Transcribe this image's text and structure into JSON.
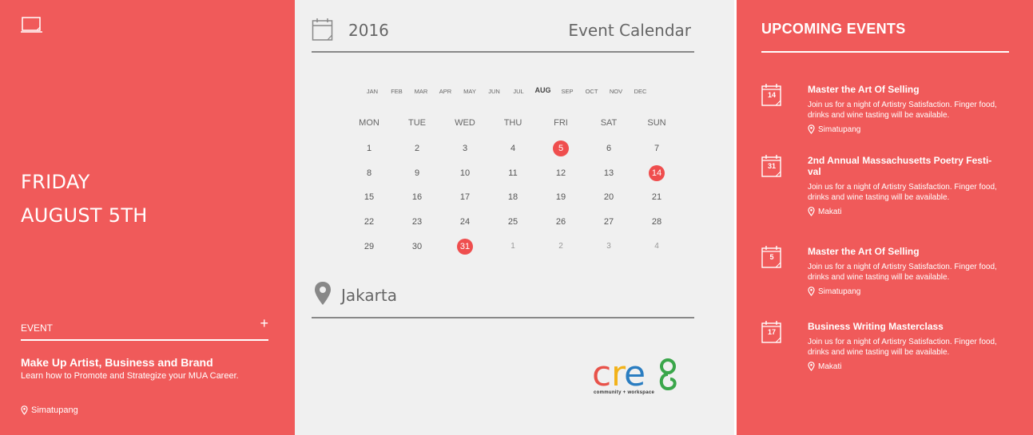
{
  "selected_date": {
    "weekday": "FRIDAY",
    "date": "AUGUST 5TH"
  },
  "event_section": {
    "heading": "EVENT",
    "add_label": "+",
    "title": "Make Up Artist, Business and Brand",
    "description": "Learn how to Promote and Strategize your MUA Career.",
    "location": "Simatupang"
  },
  "calendar": {
    "year": "2016",
    "title": "Event Calendar",
    "months": [
      "JAN",
      "FEB",
      "MAR",
      "APR",
      "MAY",
      "JUN",
      "JUL",
      "AUG",
      "SEP",
      "OCT",
      "NOV",
      "DEC"
    ],
    "active_month": "AUG",
    "weekdays": [
      "MON",
      "TUE",
      "WED",
      "THU",
      "FRI",
      "SAT",
      "SUN"
    ],
    "weeks": [
      [
        "1",
        "2",
        "3",
        "4",
        "5",
        "6",
        "7"
      ],
      [
        "8",
        "9",
        "10",
        "11",
        "12",
        "13",
        "14"
      ],
      [
        "15",
        "16",
        "17",
        "18",
        "19",
        "20",
        "21"
      ],
      [
        "22",
        "23",
        "24",
        "25",
        "26",
        "27",
        "28"
      ],
      [
        "29",
        "30",
        "31",
        "1",
        "2",
        "3",
        "4"
      ]
    ],
    "event_days": [
      "5",
      "14",
      "31"
    ],
    "next_month_days_in_last_week": 4,
    "location": "Jakarta"
  },
  "logo": {
    "text": "cre8",
    "tagline": "community + workspace",
    "colors": [
      "#e8524a",
      "#f2b21a",
      "#2a7dc1",
      "#3aa64a"
    ]
  },
  "upcoming": {
    "title": "UPCOMING EVENTS",
    "items": [
      {
        "day": "14",
        "name": "Master the Art Of Selling",
        "desc": "Join us for a night of Artistry Satisfaction. Finger food, drinks and wine tasting will be available.",
        "location": "Simatupang"
      },
      {
        "day": "31",
        "name": "2nd Annual Massachusetts Poetry Festi-val",
        "desc": "Join us for a night of Artistry Satisfaction. Finger food, drinks and wine tasting will be available.",
        "location": "Makati"
      },
      {
        "day": "5",
        "name": "Master the Art Of Selling",
        "desc": "Join us for a night of Artistry Satisfaction. Finger food, drinks and wine tasting will be available.",
        "location": "Simatupang"
      },
      {
        "day": "17",
        "name": "Business Writing Masterclass",
        "desc": "Join us for a night of Artistry Satisfaction. Finger food, drinks and wine tasting will be available.",
        "location": "Makati"
      }
    ]
  },
  "colors": {
    "accent": "#f05a5a",
    "mark": "#ef4e4e",
    "panel_bg": "#f0f0f0"
  }
}
